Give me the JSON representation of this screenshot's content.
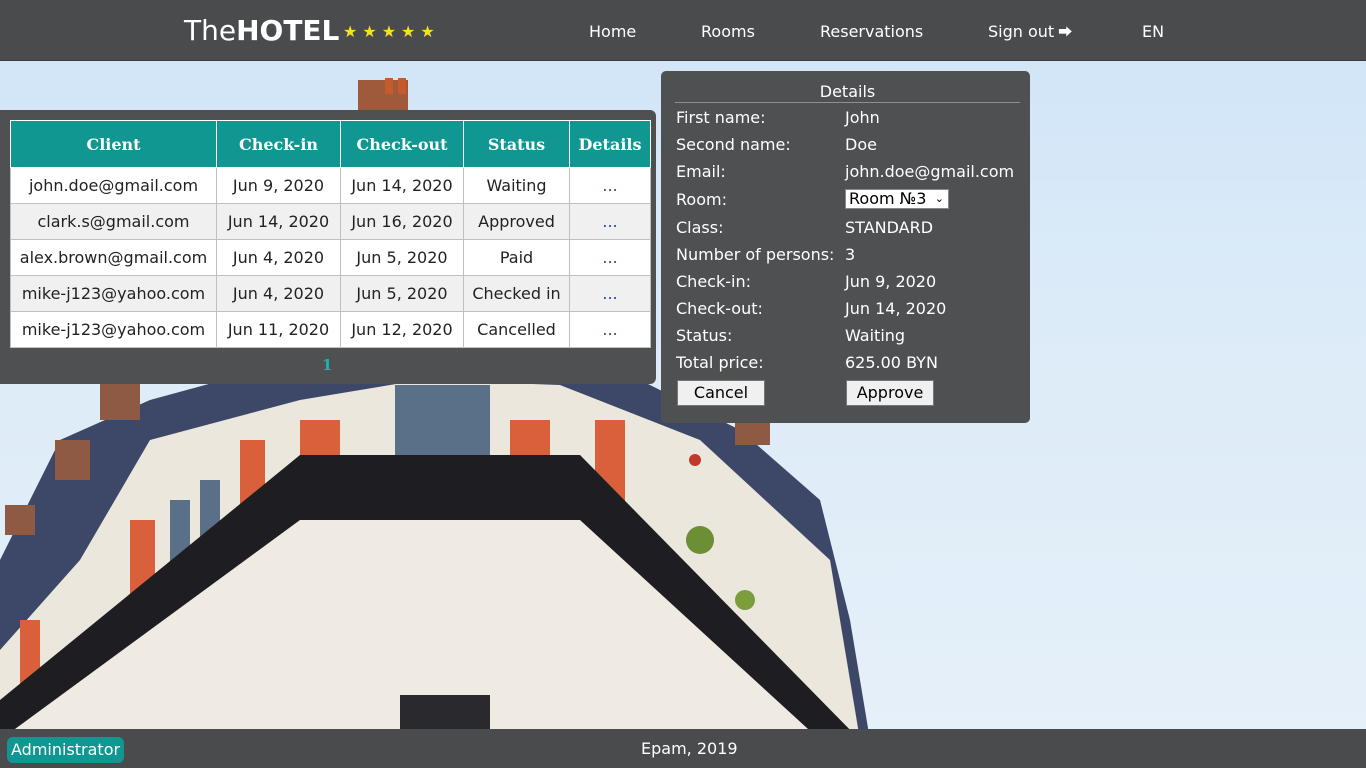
{
  "brand": {
    "the": "The",
    "hotel": "HOTEL",
    "stars": "★★★★★"
  },
  "nav": {
    "home": "Home",
    "rooms": "Rooms",
    "reservations": "Reservations",
    "sign_out": "Sign out",
    "sign_out_icon": "sign-out-icon",
    "lang": "EN"
  },
  "table": {
    "headers": [
      "Client",
      "Check-in",
      "Check-out",
      "Status",
      "Details"
    ],
    "rows": [
      {
        "client": "john.doe@gmail.com",
        "checkin": "Jun 9, 2020",
        "checkout": "Jun 14, 2020",
        "status": "Waiting",
        "details": "..."
      },
      {
        "client": "clark.s@gmail.com",
        "checkin": "Jun 14, 2020",
        "checkout": "Jun 16, 2020",
        "status": "Approved",
        "details": "..."
      },
      {
        "client": "alex.brown@gmail.com",
        "checkin": "Jun 4, 2020",
        "checkout": "Jun 5, 2020",
        "status": "Paid",
        "details": "..."
      },
      {
        "client": "mike-j123@yahoo.com",
        "checkin": "Jun 4, 2020",
        "checkout": "Jun 5, 2020",
        "status": "Checked in",
        "details": "..."
      },
      {
        "client": "mike-j123@yahoo.com",
        "checkin": "Jun 11, 2020",
        "checkout": "Jun 12, 2020",
        "status": "Cancelled",
        "details": "..."
      }
    ],
    "pages": [
      "1"
    ]
  },
  "details": {
    "title": "Details",
    "labels": {
      "first_name": "First name:",
      "second_name": "Second name:",
      "email": "Email:",
      "room": "Room:",
      "class": "Class:",
      "persons": "Number of persons:",
      "checkin": "Check-in:",
      "checkout": "Check-out:",
      "status": "Status:",
      "total": "Total price:"
    },
    "values": {
      "first_name": "John",
      "second_name": "Doe",
      "email": "john.doe@gmail.com",
      "room": "Room №3",
      "class": "STANDARD",
      "persons": "3",
      "checkin": "Jun 9, 2020",
      "checkout": "Jun 14, 2020",
      "status": "Waiting",
      "total": "625.00 BYN"
    },
    "cancel_label": "Cancel",
    "approve_label": "Approve"
  },
  "footer": {
    "role": "Administrator",
    "copyright": "Epam, 2019"
  },
  "colors": {
    "accent": "#109791",
    "bar": "#494b4d",
    "panel": "#4e5052",
    "stars": "#f1e31c"
  }
}
